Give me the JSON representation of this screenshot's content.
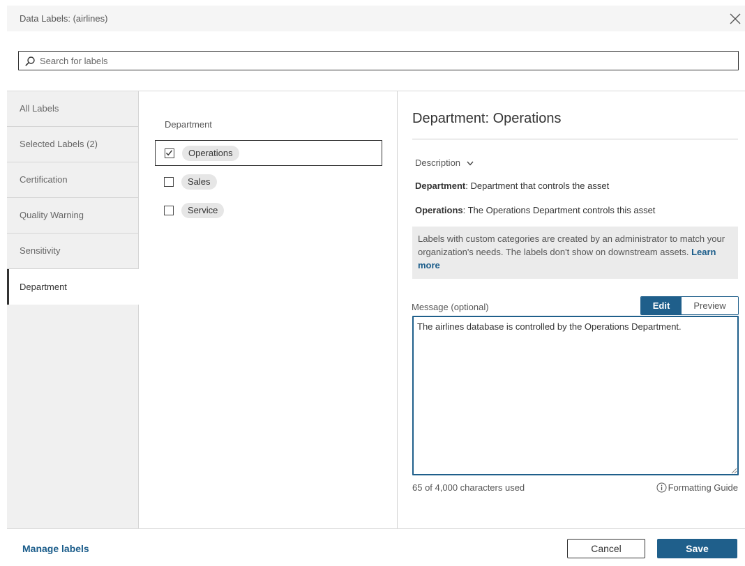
{
  "dialog": {
    "title": "Data Labels: (airlines)"
  },
  "search": {
    "placeholder": "Search for labels",
    "value": ""
  },
  "nav": {
    "items": [
      {
        "label": "All Labels"
      },
      {
        "label": "Selected Labels (2)"
      },
      {
        "label": "Certification"
      },
      {
        "label": "Quality Warning"
      },
      {
        "label": "Sensitivity"
      },
      {
        "label": "Department"
      }
    ],
    "active": "Department"
  },
  "labels": {
    "heading": "Department",
    "items": [
      {
        "name": "Operations",
        "checked": true
      },
      {
        "name": "Sales",
        "checked": false
      },
      {
        "name": "Service",
        "checked": false
      }
    ]
  },
  "detail": {
    "title": "Department: Operations",
    "description_toggle": "Description",
    "category_name": "Department",
    "category_desc": ": Department that controls the asset",
    "label_name": "Operations",
    "label_desc": ": The Operations Department controls this asset",
    "info_text": "Labels with custom categories are created by an administrator to match your organization's needs. The labels don't show on downstream assets.",
    "learn_more": "Learn more",
    "message_label": "Message (optional)",
    "edit_tab": "Edit",
    "preview_tab": "Preview",
    "message_value": "The airlines database is controlled by the Operations Department.",
    "char_count": "65 of 4,000 characters used",
    "formatting_guide": "Formatting Guide"
  },
  "footer": {
    "manage_labels": "Manage labels",
    "cancel": "Cancel",
    "save": "Save"
  },
  "colors": {
    "accent": "#1f5f8b",
    "link": "#1a5c8a",
    "nav_bg": "#f0f0f0",
    "pill_bg": "#e6e6e6",
    "info_bg": "#ebebeb"
  },
  "icons": {
    "close": "close-icon",
    "search": "search-icon",
    "chevron": "chevron-down-icon",
    "check": "checkmark-icon",
    "info": "info-icon",
    "grip": "resize-grip-icon"
  }
}
